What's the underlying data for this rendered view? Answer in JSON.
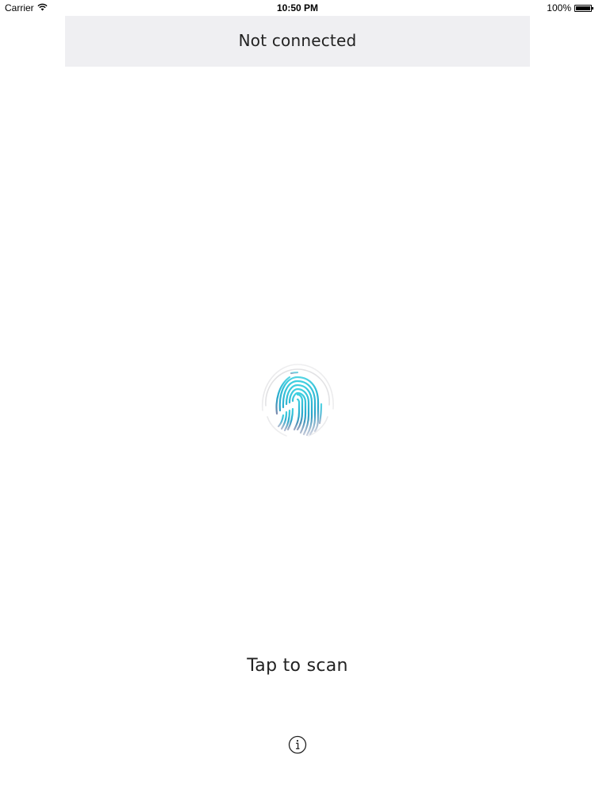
{
  "status_bar": {
    "carrier": "Carrier",
    "time": "10:50 PM",
    "battery_percent": "100%",
    "battery_level": 1.0
  },
  "header": {
    "title": "Not connected",
    "background": "#efeff2"
  },
  "scan": {
    "icon": "fingerprint-icon",
    "accent_color": "#2bb8d6",
    "label": "Tap to scan"
  },
  "info": {
    "icon": "info-icon"
  }
}
